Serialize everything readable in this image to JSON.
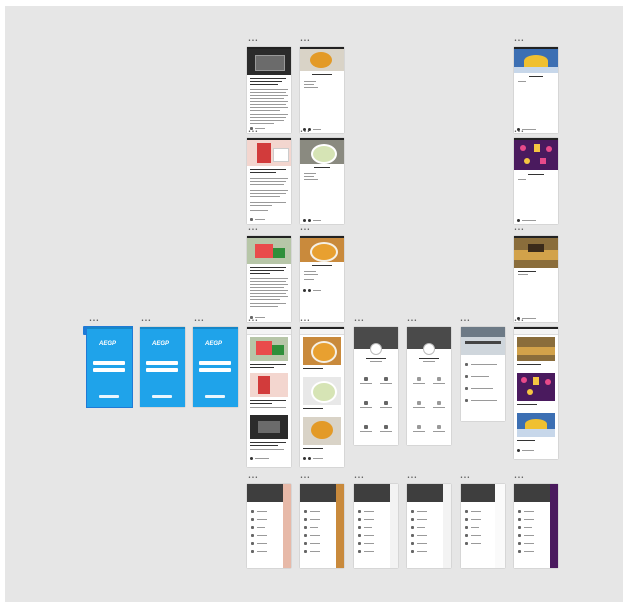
{
  "artboard_label": "•••",
  "login": {
    "logo": "AEGP"
  },
  "colors": {
    "canvas": "#e6e6e6",
    "login_blue": "#1fa3ea",
    "selection": "#1f7ad6"
  }
}
